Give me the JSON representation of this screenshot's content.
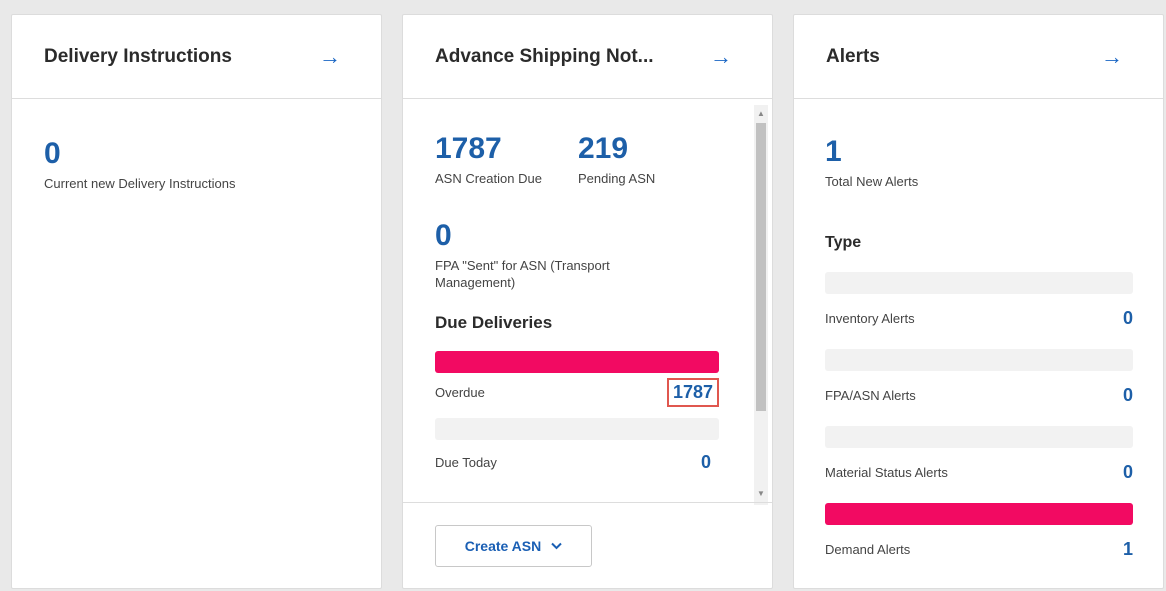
{
  "delivery": {
    "title": "Delivery Instructions",
    "count": "0",
    "count_label": "Current new Delivery Instructions"
  },
  "asn": {
    "title": "Advance Shipping Not...",
    "creation_due": "1787",
    "creation_due_label": "ASN Creation Due",
    "pending": "219",
    "pending_label": "Pending ASN",
    "fpa_sent": "0",
    "fpa_sent_label": "FPA \"Sent\" for ASN (Transport Management)",
    "due_deliveries_title": "Due Deliveries",
    "overdue_label": "Overdue",
    "overdue_value": "1787",
    "due_today_label": "Due Today",
    "due_today_value": "0",
    "create_button": "Create ASN"
  },
  "alerts": {
    "title": "Alerts",
    "total": "1",
    "total_label": "Total New Alerts",
    "type_title": "Type",
    "items": [
      {
        "label": "Inventory Alerts",
        "value": "0"
      },
      {
        "label": "FPA/ASN Alerts",
        "value": "0"
      },
      {
        "label": "Material Status Alerts",
        "value": "0"
      },
      {
        "label": "Demand Alerts",
        "value": "1"
      }
    ]
  },
  "icons": {
    "arrow": "arrow-right-icon",
    "chevron": "chevron-down-icon"
  },
  "colors": {
    "accent": "#1d5fa8",
    "bar_fill": "#f20a62",
    "bar_empty": "#f2f2f2",
    "highlight": "#e0574f"
  }
}
